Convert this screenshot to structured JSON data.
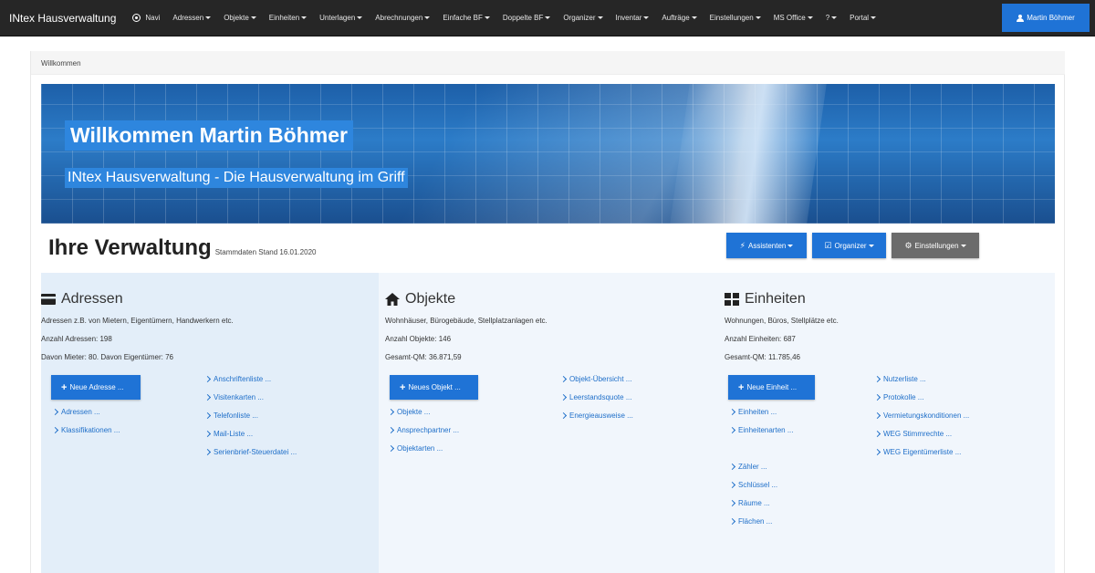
{
  "navbar": {
    "brand": "INtex Hausverwaltung",
    "items": [
      {
        "label": "Navi",
        "caret": false
      },
      {
        "label": "Adressen",
        "caret": true
      },
      {
        "label": "Objekte",
        "caret": true
      },
      {
        "label": "Einheiten",
        "caret": true
      },
      {
        "label": "Unterlagen",
        "caret": true
      },
      {
        "label": "Abrechnungen",
        "caret": true
      },
      {
        "label": "Einfache BF",
        "caret": true
      },
      {
        "label": "Doppelte BF",
        "caret": true
      },
      {
        "label": "Organizer",
        "caret": true
      },
      {
        "label": "Inventar",
        "caret": true
      },
      {
        "label": "Aufträge",
        "caret": true
      },
      {
        "label": "Einstellungen",
        "caret": true
      },
      {
        "label": "MS Office",
        "caret": true
      },
      {
        "label": "?",
        "caret": true
      },
      {
        "label": "Portal",
        "caret": true
      }
    ],
    "user": "Martin Böhmer"
  },
  "breadcrumb": "Willkommen",
  "banner": {
    "title": "Willkommen Martin Böhmer",
    "subtitle": "INtex Hausverwaltung - Die Hausverwaltung im Griff"
  },
  "heading": {
    "title": "Ihre Verwaltung",
    "stand": "Stammdaten Stand 16.01.2020"
  },
  "actions": {
    "assistenten": "Assistenten",
    "organizer": "Organizer",
    "einstellungen": "Einstellungen"
  },
  "sections": {
    "adressen": {
      "title": "Adressen",
      "desc": "Adressen z.B. von Mietern, Eigentümern, Handwerkern etc.",
      "stat1": "Anzahl Adressen: 198",
      "stat2": "Davon Mieter: 80. Davon Eigentümer: 76",
      "new_btn": "Neue Adresse ...",
      "links_left": [
        "Adressen ...",
        "Klassifikationen ..."
      ],
      "links_right": [
        "Anschriftenliste ...",
        "Visitenkarten ...",
        "Telefonliste ...",
        "Mail-Liste ...",
        "Serienbrief-Steuerdatei ..."
      ]
    },
    "objekte": {
      "title": "Objekte",
      "desc": "Wohnhäuser, Bürogebäude, Stellplatzanlagen etc.",
      "stat1": "Anzahl Objekte: 146",
      "stat2": "Gesamt-QM: 36.871,59",
      "new_btn": "Neues Objekt ...",
      "links_left": [
        "Objekte ...",
        "Ansprechpartner ...",
        "Objektarten ..."
      ],
      "links_right": [
        "Objekt-Übersicht ...",
        "Leerstandsquote ...",
        "Energieausweise ..."
      ]
    },
    "einheiten": {
      "title": "Einheiten",
      "desc": "Wohnungen, Büros, Stellplätze etc.",
      "stat1": "Anzahl Einheiten: 687",
      "stat2": "Gesamt-QM: 11.785,46",
      "new_btn": "Neue Einheit ...",
      "links_left": [
        "Einheiten ...",
        "Einheitenarten ..."
      ],
      "links_left2": [
        "Zähler ...",
        "Schlüssel ...",
        "Räume ...",
        "Flächen ..."
      ],
      "links_right": [
        "Nutzerliste ...",
        "Protokolle ...",
        "Vermietungskonditionen ...",
        "WEG Stimmrechte ...",
        "WEG Eigentümerliste ..."
      ]
    }
  }
}
